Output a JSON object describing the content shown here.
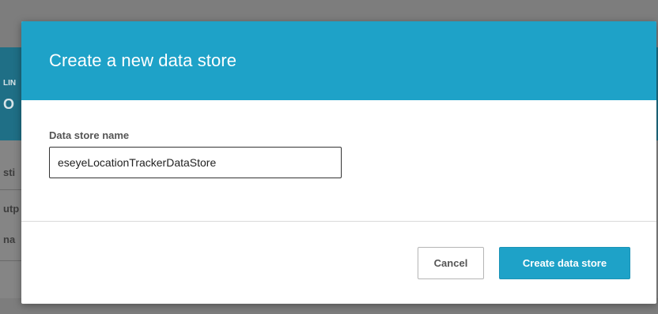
{
  "background": {
    "fragments": [
      "LIN",
      "O",
      "sti",
      "utp",
      "na"
    ]
  },
  "dialog": {
    "title": "Create a new data store",
    "field": {
      "label": "Data store name",
      "value": "eseyeLocationTrackerDataStore"
    },
    "buttons": {
      "cancel": "Cancel",
      "create": "Create data store"
    }
  },
  "colors": {
    "header": "#1ea2c8",
    "primary_button": "#1ea2c8",
    "overlay": "#7d7d7d"
  }
}
